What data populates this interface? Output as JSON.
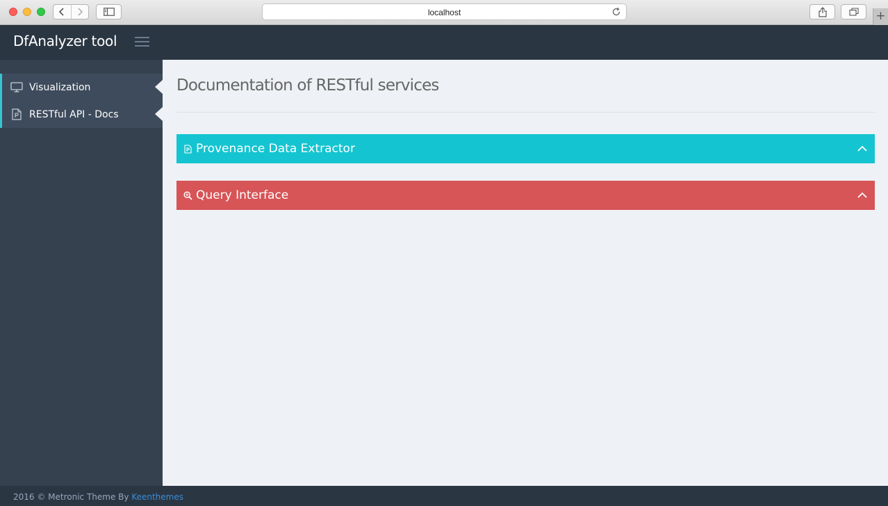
{
  "browser": {
    "address": "localhost",
    "new_tab_label": "+"
  },
  "header": {
    "brand": "DfAnalyzer tool"
  },
  "sidebar": {
    "items": [
      {
        "label": "Visualization",
        "icon": "monitor-icon"
      },
      {
        "label": "RESTful API - Docs",
        "icon": "document-icon"
      }
    ]
  },
  "main": {
    "page_title": "Documentation of RESTful services",
    "panels": [
      {
        "title": "Provenance Data Extractor",
        "icon": "document-icon",
        "color": "#14c5d1",
        "state": "expanded"
      },
      {
        "title": "Query Interface",
        "icon": "search-zoom-icon",
        "color": "#d75457",
        "state": "expanded"
      }
    ]
  },
  "footer": {
    "text": "2016 © Metronic Theme By ",
    "link_text": "Keenthemes"
  },
  "colors": {
    "topbar": "#2b3643",
    "sidebar": "#364150",
    "sidebar_active": "#3e4b5c",
    "accent": "#36c6d3",
    "content_bg": "#eef1f5"
  }
}
